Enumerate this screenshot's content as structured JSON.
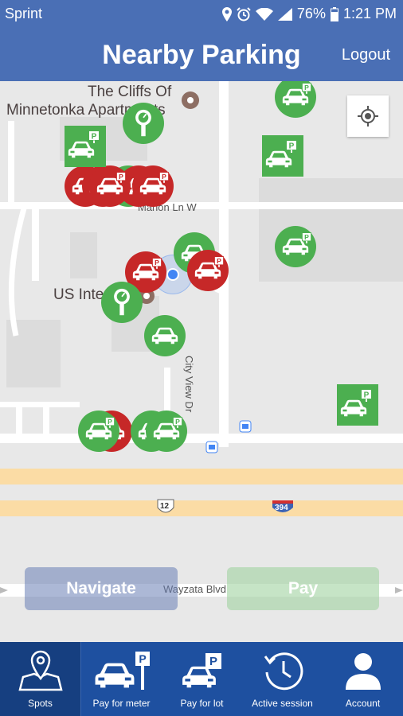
{
  "status_bar": {
    "carrier": "Sprint",
    "battery": "76%",
    "time": "1:21 PM"
  },
  "header": {
    "title": "Nearby Parking",
    "logout_label": "Logout"
  },
  "map": {
    "poi_labels": [
      "The Cliffs Of",
      "Minnetonka Apartments",
      "US Inte"
    ],
    "road_labels": [
      "Marion Ln W",
      "City View Dr",
      "Wayzata Blvd"
    ],
    "highway_shields": [
      "12",
      "394"
    ]
  },
  "actions": {
    "navigate_label": "Navigate",
    "pay_label": "Pay"
  },
  "bottom_nav": {
    "items": [
      {
        "label": "Spots",
        "icon": "map-pin-icon",
        "active": true
      },
      {
        "label": "Pay for meter",
        "icon": "car-meter-icon",
        "active": false
      },
      {
        "label": "Pay for lot",
        "icon": "car-lot-icon",
        "active": false
      },
      {
        "label": "Active session",
        "icon": "clock-history-icon",
        "active": false
      },
      {
        "label": "Account",
        "icon": "person-icon",
        "active": false
      }
    ]
  },
  "colors": {
    "brand": "#4a6fb5",
    "nav": "#1e50a0",
    "available": "#4caf50",
    "occupied": "#c62828"
  }
}
